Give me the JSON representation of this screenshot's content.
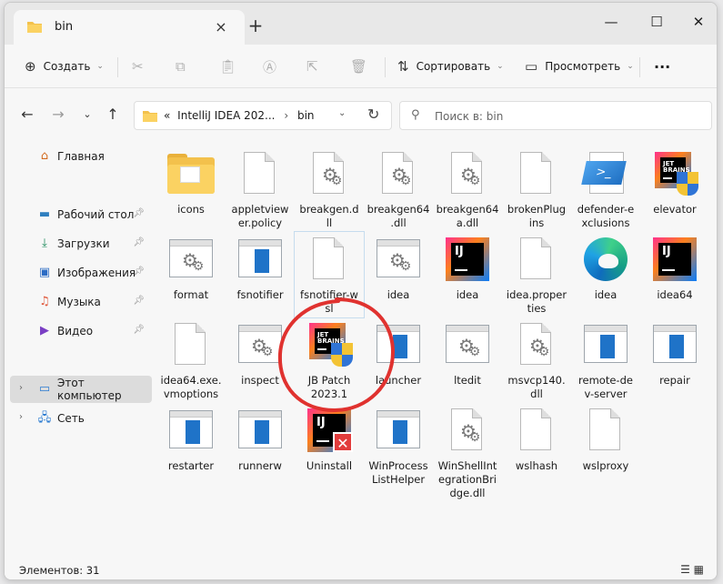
{
  "window": {
    "tab_title": "bin",
    "close_tab": "×",
    "new_tab": "+",
    "minimize": "—",
    "maximize": "☐",
    "close": "✕"
  },
  "toolbar": {
    "create_label": "Создать",
    "sort_label": "Сортировать",
    "view_label": "Просмотреть",
    "more_label": "···",
    "icons": [
      "plus-circle-icon",
      "cut-icon",
      "copy-icon",
      "paste-icon",
      "rename-icon",
      "share-icon",
      "delete-icon",
      "sort-icon",
      "view-icon"
    ]
  },
  "address": {
    "crumb_overflow": "«",
    "crumb_1": "IntelliJ IDEA 202...",
    "crumb_2": "bin",
    "chev": "›",
    "search_placeholder": "Поиск в: bin"
  },
  "sidebar": {
    "home": "Главная",
    "items": [
      {
        "label": "Рабочий стол",
        "icon": "desktop-icon"
      },
      {
        "label": "Загрузки",
        "icon": "download-icon"
      },
      {
        "label": "Изображения",
        "icon": "images-icon"
      },
      {
        "label": "Музыка",
        "icon": "music-icon"
      },
      {
        "label": "Видео",
        "icon": "video-icon"
      }
    ],
    "this_pc": "Этот компьютер",
    "network": "Сеть"
  },
  "files": [
    {
      "name": "icons",
      "type": "folder"
    },
    {
      "name": "appletviewer.policy",
      "type": "doc"
    },
    {
      "name": "breakgen.dll",
      "type": "dll"
    },
    {
      "name": "breakgen64.dll",
      "type": "dll"
    },
    {
      "name": "breakgen64a.dll",
      "type": "dll"
    },
    {
      "name": "brokenPlugins",
      "type": "doc"
    },
    {
      "name": "defender-exclusions",
      "type": "ps"
    },
    {
      "name": "elevator",
      "type": "jbshield"
    },
    {
      "name": "format",
      "type": "exe-gear"
    },
    {
      "name": "fsnotifier",
      "type": "exe-blue"
    },
    {
      "name": "fsnotifier-wsl",
      "type": "doc"
    },
    {
      "name": "idea",
      "type": "exe-gear"
    },
    {
      "name": "idea",
      "type": "ij"
    },
    {
      "name": "idea.properties",
      "type": "doc"
    },
    {
      "name": "idea",
      "type": "edge"
    },
    {
      "name": "idea64",
      "type": "ij"
    },
    {
      "name": "idea64.exe.vmoptions",
      "type": "doc"
    },
    {
      "name": "inspect",
      "type": "exe-gear"
    },
    {
      "name": "JB Patch 2023.1",
      "type": "jbshield"
    },
    {
      "name": "launcher",
      "type": "exe-blue"
    },
    {
      "name": "ltedit",
      "type": "exe-gear"
    },
    {
      "name": "msvcp140.dll",
      "type": "dll"
    },
    {
      "name": "remote-dev-server",
      "type": "exe-blue"
    },
    {
      "name": "repair",
      "type": "exe-blue"
    },
    {
      "name": "restarter",
      "type": "exe-blue"
    },
    {
      "name": "runnerw",
      "type": "exe-blue"
    },
    {
      "name": "Uninstall",
      "type": "ij-x"
    },
    {
      "name": "WinProcessListHelper",
      "type": "exe-blue"
    },
    {
      "name": "WinShellIntegrationBridge.dll",
      "type": "dll"
    },
    {
      "name": "wslhash",
      "type": "doc"
    },
    {
      "name": "wslproxy",
      "type": "doc"
    }
  ],
  "labels": [
    "icons",
    "appletview\ner.policy",
    "breakgen.d\nll",
    "breakgen64\n.dll",
    "breakgen64\na.dll",
    "brokenPlug\nins",
    "defender-e\nxclusions",
    "elevator",
    "format",
    "fsnotifier",
    "fsnotifier-w\nsl",
    "idea",
    "idea",
    "idea.proper\nties",
    "idea",
    "idea64",
    "idea64.exe.\nvmoptions",
    "inspect",
    "JB Patch\n2023.1",
    "launcher",
    "ltedit",
    "msvcp140.\ndll",
    "remote-de\nv-server",
    "repair",
    "restarter",
    "runnerw",
    "Uninstall",
    "WinProcess\nListHelper",
    "WinShellInt\negrationBri\ndge.dll",
    "wslhash",
    "wslproxy"
  ],
  "status": {
    "count": "Элементов: 31",
    "views": "☰  ▦"
  },
  "colors": {
    "accent": "#1f73c8",
    "annotation": "#e0322f",
    "folder": "#fbd262"
  }
}
